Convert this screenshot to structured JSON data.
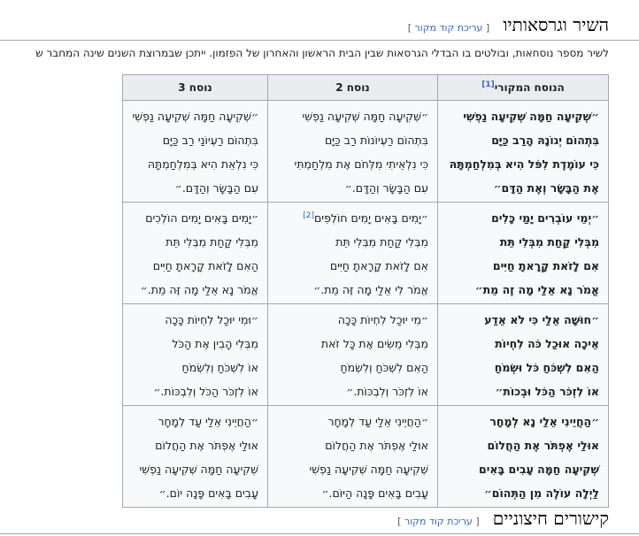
{
  "section1": {
    "title": "השיר וגרסאותיו",
    "edit_label": "עריכת קוד מקור",
    "intro": "לשיר מספר נוסחאות, ובולטים בו הבדלי הגרסאות שבין הבית הראשון והאחרון של הפזמון. ייתכן שבמרוצת השנים שינה המחבר ש"
  },
  "table": {
    "headers": [
      {
        "label": "הנוסח המקורי",
        "ref": "[1]"
      },
      {
        "label": "נוסח 2",
        "ref": ""
      },
      {
        "label": "נוסח 3",
        "ref": ""
      }
    ],
    "rows": [
      {
        "orig": [
          "״שְׁקִיעָה חַמָּה שְׁקִיעָה נַפְשִׁי",
          "בִּתְהוֹם יְגוֹנָהּ הָרַב כַּיָּם",
          "כִּי עוֹמֶדֶת לִפֹּל הִיא בְּמִלְחַמְתָּהּ",
          "אֶת הַבָּשָׂר וְאֶת הַדָּם״"
        ],
        "v2": [
          "״שְׁקִיעָה חַמָּה שְׁקִיעָה נַפְשִׁי",
          "בִּתְהוֹם רַעְיוֹנוֹת רַב כַּיָּם",
          "כִּי נִלְאֵיתִי מִלְּחֹם אֶת מִלְחַמְתִּי",
          "עִם הַבָּשָׂר וְהַדָּם.״"
        ],
        "v3": [
          "״שְׁקִיעָה חַמָּה שְׁקִיעָה נַפְשִׁי",
          "בִּתְהוֹם רַעְיוֹנַי רַב כַּיָּם",
          "כִּי נִלְאֵת הִיא בְּמִלְחַמְתָּהּ",
          "עִם הַבָּשָׂר וְהַדָּם.״"
        ]
      },
      {
        "orig": [
          "״יְמֵי עוֹבְרִים יָמַי כָּלִים",
          "מִבְּלִי קַחַת מִבְּלִי תֵּת",
          "אִם לָזֹאת קָרָאתָ חַיִּים",
          "אֱמֹר נָא אֵלַי מָה זֶה מֵת״"
        ],
        "v2": [
          "״יָמִים בָּאִים יָמִים חוֹלְפִים",
          "מִבְּלִי קַחַת מִבְּלִי תֵּת",
          "אִם לָזֹאת קָרָאתָ חַיִּים",
          "אֱמֹר לִי אֵלַי מָה זֶּה מֵת.״"
        ],
        "v2_ref": "[2]",
        "v3": [
          "״יָמִים בָּאִים יָמִים הוֹלְכִים",
          "מִבְּלִי קַחַת מִבְּלִי תֵּת",
          "הַאִם לָזֹאת קָרָאתָ חַיִּים",
          "אֱמֹר נָא אֵלַי מָה זֶּה מֵת.״"
        ]
      },
      {
        "orig": [
          "״חוּשָׁה אֵלַי כִּי לֹא אֵדַע",
          "אֵיכָה אוּכַל כֹּה לִחְיוֹת",
          "הַאִם לִשְׁכֹּחַ כֹּל וּשְׂמֹחַ",
          "אוֹ לִזְכֹּר הַכֹּל וּבְכוֹת״"
        ],
        "v2": [
          "״מִי יוּכַל לִחְיוֹת כָּכָה",
          "מִבְּלִי מֵשִׂים אֶת כָּל זֹאת",
          "הַאִם לִשְׁכֹּחַ וְלִשְׂמֹחַ",
          "אוֹ לִזְכֹּר וְלִבְכּוֹת.״"
        ],
        "v3": [
          "״וּמִי יוּכַל לִחְיוֹת כָּכָה",
          "מִבְּלִי הָבִין אֶת הַכֹּל",
          "אוֹ לִשְׁכֹּחַ וְלִשְׂמֹחַ",
          "אוֹ לִזְכֹּר הַכֹּל וְלִבְכּוֹת.״"
        ]
      },
      {
        "orig": [
          "״הַחֲיֵינִי אֵלַי נָא לְמָחָר",
          "אוּלַי אֶפְתֹּר אֶת הַחֲלוֹם",
          "שְׁקִיעָה חַמָּה עָבִים בָּאִים",
          "לַיְלָה עוֹלֶה מִן הַתְּהוֹם״"
        ],
        "v2": [
          "״הַחֲיֵינִי אֵלַי עַד לְמָחָר",
          "אוּלַי אֶפְתֹּר אֶת הַחֲלוֹם",
          "שְׁקִיעָה חַמָּה שְׁקִיעָה נַפְשִׁי",
          "עָבִים בָּאִים פָּנָה הַיּוֹם.״"
        ],
        "v3": [
          "״הַחֲיֵינִי אֵלַי עַד לְמָחָר",
          "אוּלַי אֶפְתֹּר אֶת הַחֲלוֹם",
          "שְׁקִיעָה חַמָּה שְׁקִיעָה נַפְשִׁי",
          "עָבִים בָּאִים פָּנָה יוֹם.״"
        ]
      }
    ]
  },
  "section2": {
    "title": "קישורים חיצוניים",
    "edit_label": "עריכת קוד מקור"
  }
}
